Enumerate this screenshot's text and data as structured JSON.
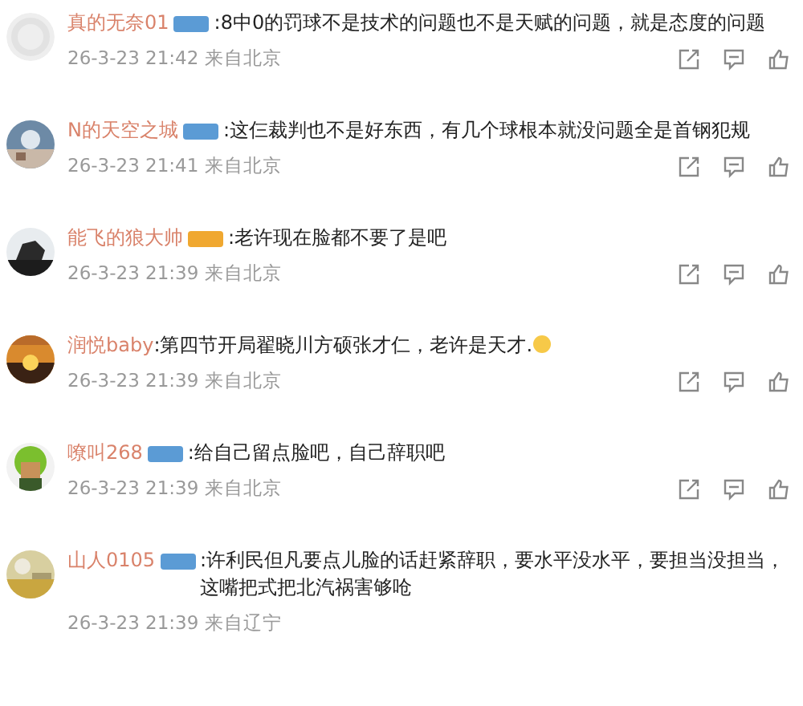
{
  "comments": [
    {
      "user": "真的无奈01",
      "avatar": {
        "kind": "default"
      },
      "badge": {
        "color": "#5b9bd5"
      },
      "text": ":8中0的罚球不是技术的问题也不是天赋的问题，就是态度的问题",
      "emoji": false,
      "time": "26-3-23 21:42 来自北京",
      "actions": true
    },
    {
      "user": "N的天空之城",
      "badge": {
        "color": "#5b9bd5"
      },
      "text": ":这仨裁判也不是好东西，有几个球根本就没问题全是首钢犯规",
      "emoji": false,
      "time": "26-3-23 21:41 来自北京",
      "actions": true
    },
    {
      "user": "能飞的狼大帅",
      "badge": {
        "color": "#f0a830"
      },
      "text": ":老许现在脸都不要了是吧",
      "emoji": false,
      "time": "26-3-23 21:39 来自北京",
      "actions": true
    },
    {
      "user": "润悦baby",
      "text": ":第四节开局翟晓川方硕张才仁，老许是天才.",
      "emoji": true,
      "time": "26-3-23 21:39 来自北京",
      "actions": true
    },
    {
      "user": "嘹叫268",
      "badge": {
        "color": "#5b9bd5"
      },
      "text": ":给自己留点脸吧，自己辞职吧",
      "emoji": false,
      "time": "26-3-23 21:39 来自北京",
      "actions": true
    },
    {
      "user": "山人0105",
      "badge": {
        "color": "#5b9bd5"
      },
      "text": ":许利民但凡要点儿脸的话赶紧辞职，要水平没水平，要担当没担当，这嘴把式把北汽祸害够呛",
      "emoji": false,
      "time": "26-3-23 21:39 来自辽宁",
      "actions": false
    }
  ]
}
